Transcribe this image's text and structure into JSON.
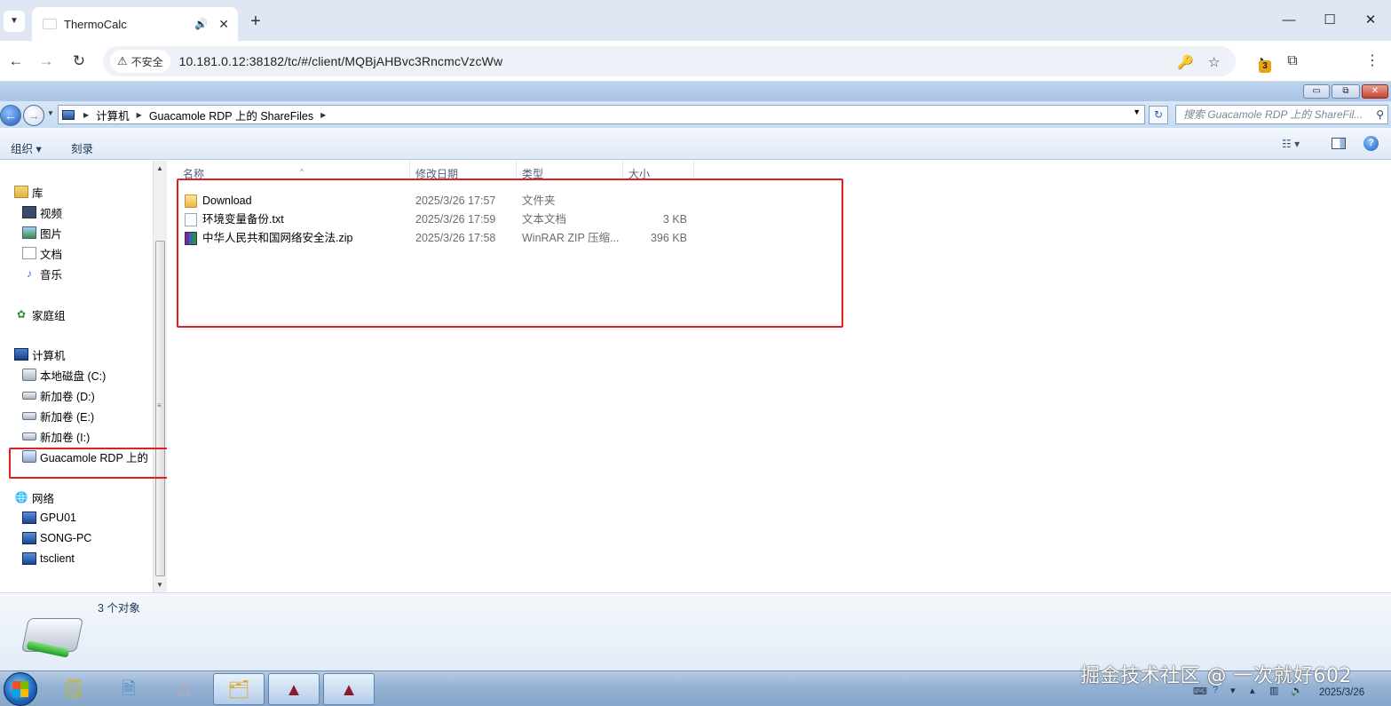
{
  "browser": {
    "tab_title": "ThermoCalc",
    "new_tab": "+",
    "security_label": "不安全",
    "url": "10.181.0.12:38182/tc/#/client/MQBjAHBvc3RncmcVzcWw",
    "extension_badge": "3"
  },
  "explorer": {
    "breadcrumb": [
      "计算机",
      "Guacamole RDP 上的 ShareFiles"
    ],
    "search_placeholder": "搜索 Guacamole RDP 上的 ShareFil...",
    "commands": {
      "organize": "组织 ▾",
      "burn": "刻录"
    },
    "nav": {
      "libraries": "库",
      "videos": "视频",
      "pictures": "图片",
      "documents": "文档",
      "music": "音乐",
      "homegroup": "家庭组",
      "computer": "计算机",
      "drive_c": "本地磁盘 (C:)",
      "drive_d": "新加卷 (D:)",
      "drive_e": "新加卷 (E:)",
      "drive_i": "新加卷 (I:)",
      "guacamole": "Guacamole RDP 上的",
      "network": "网络",
      "net_gpu01": "GPU01",
      "net_song": "SONG-PC",
      "net_tsclient": "tsclient"
    },
    "columns": {
      "name": "名称",
      "date": "修改日期",
      "type": "类型",
      "size": "大小"
    },
    "files": [
      {
        "name": "Download",
        "date": "2025/3/26 17:57",
        "type": "文件夹",
        "size": ""
      },
      {
        "name": "环境变量备份.txt",
        "date": "2025/3/26 17:59",
        "type": "文本文档",
        "size": "3 KB"
      },
      {
        "name": "中华人民共和国网络安全法.zip",
        "date": "2025/3/26 17:58",
        "type": "WinRAR ZIP 压缩...",
        "size": "396 KB"
      }
    ],
    "status_count": "3 个对象"
  },
  "taskbar": {
    "date": "2025/3/26"
  },
  "watermark": "掘金技术社区 @ 一次就好602",
  "colors": {
    "highlight": "#e32020",
    "explorer_accent": "#1e395b"
  }
}
